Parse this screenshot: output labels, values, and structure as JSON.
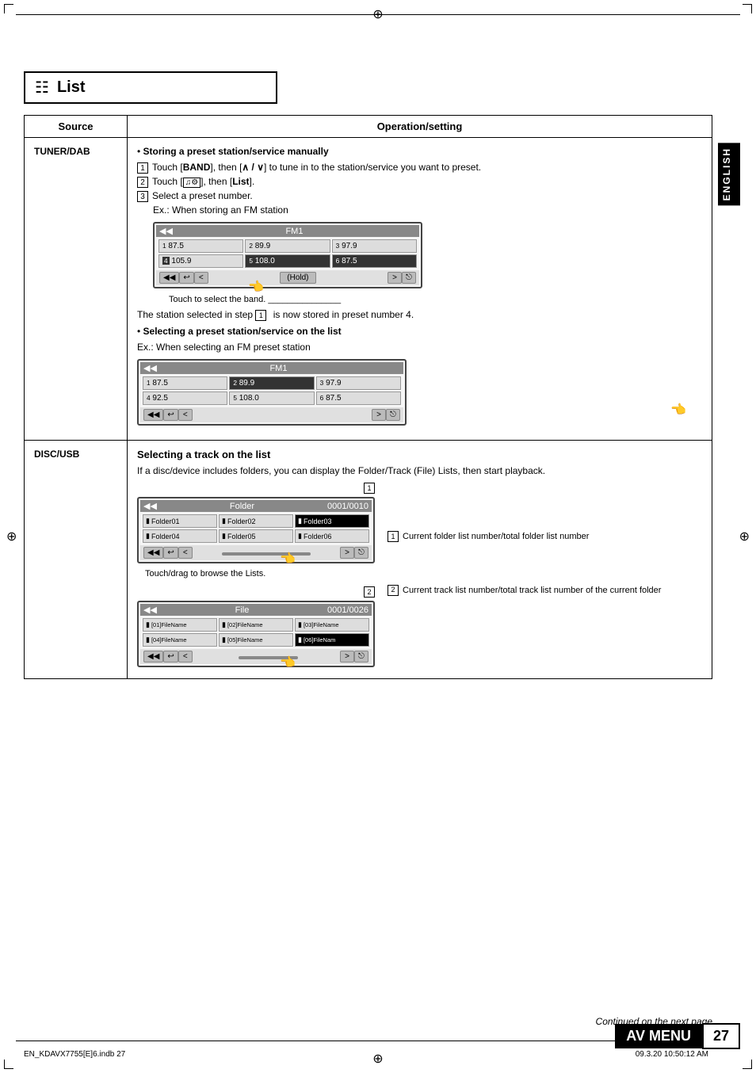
{
  "page": {
    "corner_marks": true,
    "crosshair_symbol": "⊕",
    "english_label": "ENGLISH"
  },
  "list_section": {
    "icon": "≡",
    "title": "List"
  },
  "table": {
    "col1_header": "Source",
    "col2_header": "Operation/setting",
    "rows": [
      {
        "source": "TUNER/DAB",
        "sections": [
          {
            "type": "bullet",
            "title": "Storing a preset station/service manually",
            "steps": [
              {
                "num": "1",
                "text": "Touch [BAND], then [∧/∨] to tune in to the station/service you want to preset."
              },
              {
                "num": "2",
                "text": "Touch [   ], then [List]."
              },
              {
                "num": "3",
                "text": "Select a preset number."
              }
            ],
            "example": "Ex.: When storing an FM station",
            "fm_display1": {
              "title": "FM1",
              "cells": [
                {
                  "num": "1",
                  "val": "87.5"
                },
                {
                  "num": "2",
                  "val": "89.9"
                },
                {
                  "num": "3",
                  "val": "97.9"
                },
                {
                  "num": "4",
                  "val": "105.9",
                  "active": true
                },
                {
                  "num": "5",
                  "val": "108.0"
                },
                {
                  "num": "6",
                  "val": "87.5",
                  "active": true
                }
              ]
            },
            "touch_caption": "Touch to select the band.",
            "note": "The station selected in step 1 is now stored in preset number 4."
          },
          {
            "type": "bullet",
            "title": "Selecting a preset station/service on the list",
            "example": "Ex.: When selecting an FM preset station",
            "fm_display2": {
              "title": "FM1",
              "cells": [
                {
                  "num": "1",
                  "val": "87.5"
                },
                {
                  "num": "2",
                  "val": "89.9",
                  "active": true
                },
                {
                  "num": "3",
                  "val": "97.9"
                },
                {
                  "num": "4",
                  "val": "92.5"
                },
                {
                  "num": "5",
                  "val": "108.0"
                },
                {
                  "num": "6",
                  "val": "87.5"
                }
              ]
            }
          }
        ]
      },
      {
        "source": "DISC/USB",
        "disc_title": "Selecting a track on the list",
        "disc_body": "If a disc/device includes folders, you can display the Folder/Track (File) Lists, then start playback.",
        "folder_display": {
          "title": "Folder",
          "counter": "0001/0010",
          "cells": [
            {
              "name": "Folder01"
            },
            {
              "name": "Folder02"
            },
            {
              "name": "Folder03",
              "highlight": true
            },
            {
              "name": "Folder04"
            },
            {
              "name": "Folder05"
            },
            {
              "name": "Folder06"
            }
          ]
        },
        "touch_drag_caption": "Touch/drag to browse the Lists.",
        "file_display": {
          "title": "File",
          "counter": "0001/0026",
          "cells": [
            {
              "name": "[01]FileName"
            },
            {
              "name": "[02]FileName"
            },
            {
              "name": "[03]FileName"
            },
            {
              "name": "[04]FileName"
            },
            {
              "name": "[05]FileName"
            },
            {
              "name": "[06]FileNam",
              "highlight": true
            }
          ]
        },
        "notes": [
          {
            "num": "1",
            "lines": [
              "Current folder list",
              "number/total folder list",
              "number"
            ]
          },
          {
            "num": "2",
            "lines": [
              "Current track list",
              "number/total track list",
              "number of the current",
              "folder"
            ]
          }
        ]
      }
    ]
  },
  "footer": {
    "continued": "Continued on the next page",
    "av_menu": "AV MENU",
    "page_num": "27",
    "file_info": "EN_KDAVX7755[E]6.indb  27",
    "date_info": "09.3.20  10:50:12 AM"
  }
}
